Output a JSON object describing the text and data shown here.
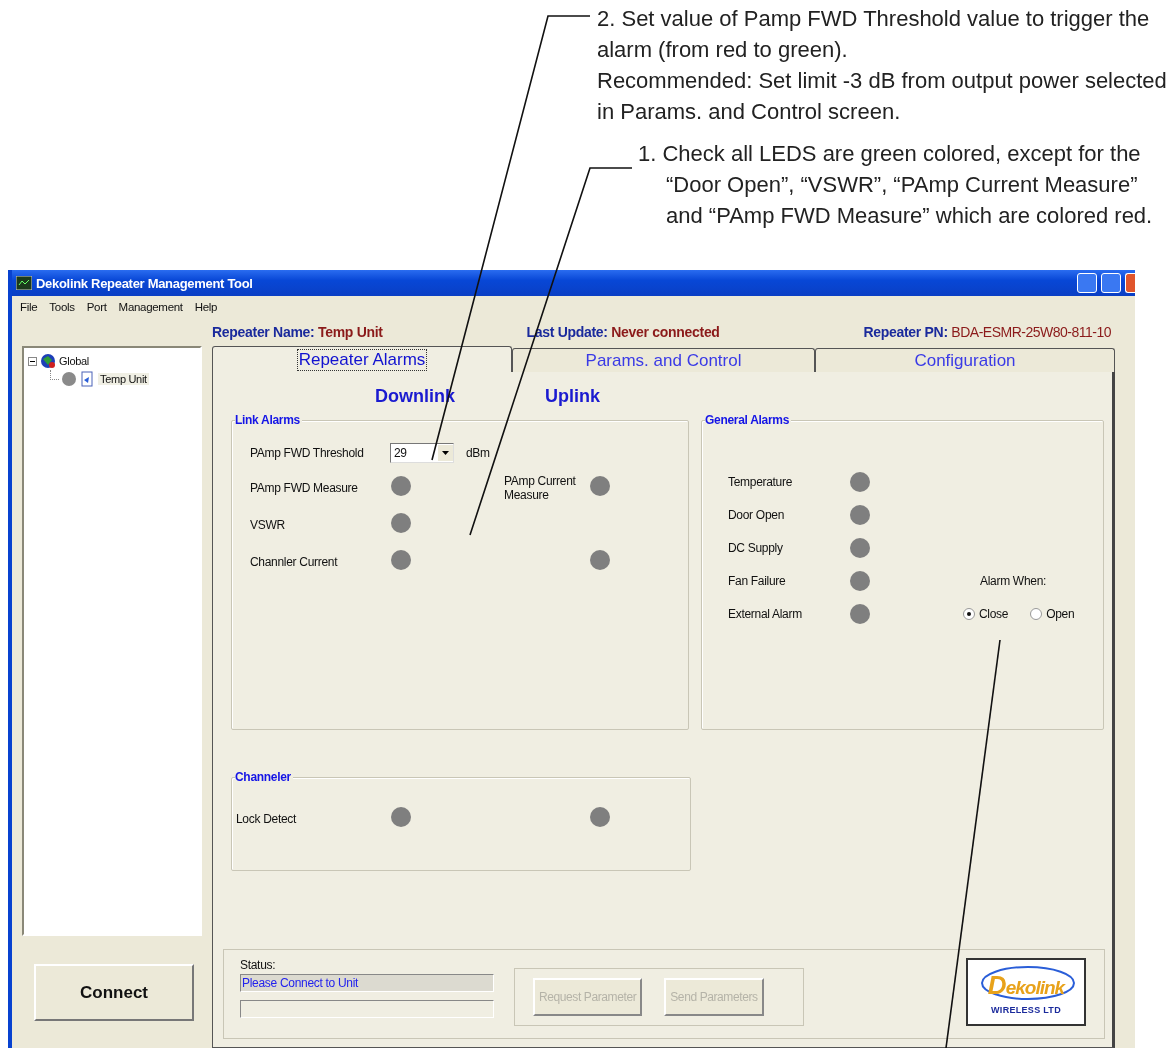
{
  "annotations": [
    {
      "paragraphs": [
        "2. Set value of Pamp FWD Threshold value to trigger the alarm (from red to green).",
        "Recommended: Set limit -3 dB from output power selected in Params. and Control screen."
      ]
    },
    {
      "paragraphs": [
        "1. Check all LEDS are green colored, except for the “Door Open”, “VSWR”, “PAmp Current Measure” and “PAmp FWD Measure” which are colored red."
      ]
    }
  ],
  "window": {
    "title": "Dekolink Repeater Management Tool"
  },
  "menu": [
    "File",
    "Tools",
    "Port",
    "Management",
    "Help"
  ],
  "header": [
    {
      "label": "Repeater Name:",
      "value": "Temp Unit"
    },
    {
      "label": "Last Update:",
      "value": "Never connected"
    },
    {
      "label": "Repeater PN:",
      "value": "BDA-ESMR-25W80-811-10"
    }
  ],
  "tree": [
    {
      "label": "Global",
      "selected": false,
      "expanded": true,
      "children": [
        {
          "label": "Temp Unit",
          "selected": true
        }
      ]
    }
  ],
  "connect_button": "Connect",
  "tabs": [
    {
      "label": "Repeater Alarms",
      "selected": true
    },
    {
      "label": "Params. and Control",
      "selected": false
    },
    {
      "label": "Configuration",
      "selected": false
    }
  ],
  "columns": [
    "Downlink",
    "Uplink"
  ],
  "link_alarms": {
    "title": "Link Alarms",
    "threshold": {
      "label": "PAmp FWD Threshold",
      "value": "29",
      "unit": "dBm"
    },
    "rows": [
      {
        "label": "PAmp FWD Measure",
        "uplink_label": "PAmp Current Measure",
        "uplink_led": true
      },
      {
        "label": "VSWR",
        "uplink_led": false
      },
      {
        "label": "Channler Current",
        "uplink_led": true
      }
    ]
  },
  "general_alarms": {
    "title": "General Alarms",
    "rows": [
      "Temperature",
      "Door Open",
      "DC Supply",
      "Fan Failure",
      "External Alarm"
    ],
    "alarm_when": {
      "label": "Alarm When:",
      "options": [
        {
          "label": "Close",
          "selected": true
        },
        {
          "label": "Open",
          "selected": false
        }
      ]
    }
  },
  "channeler": {
    "title": "Channeler",
    "rows": [
      {
        "label": "Lock Detect",
        "uplink_led": true
      }
    ]
  },
  "status": {
    "label": "Status:",
    "message": "Please Connect to Unit"
  },
  "buttons": [
    {
      "label": "Request Parameter",
      "disabled": true
    },
    {
      "label": "Send Parameters",
      "disabled": true
    }
  ],
  "logo": {
    "text": "Dekolink",
    "tagline": "WIRELESS LTD"
  }
}
